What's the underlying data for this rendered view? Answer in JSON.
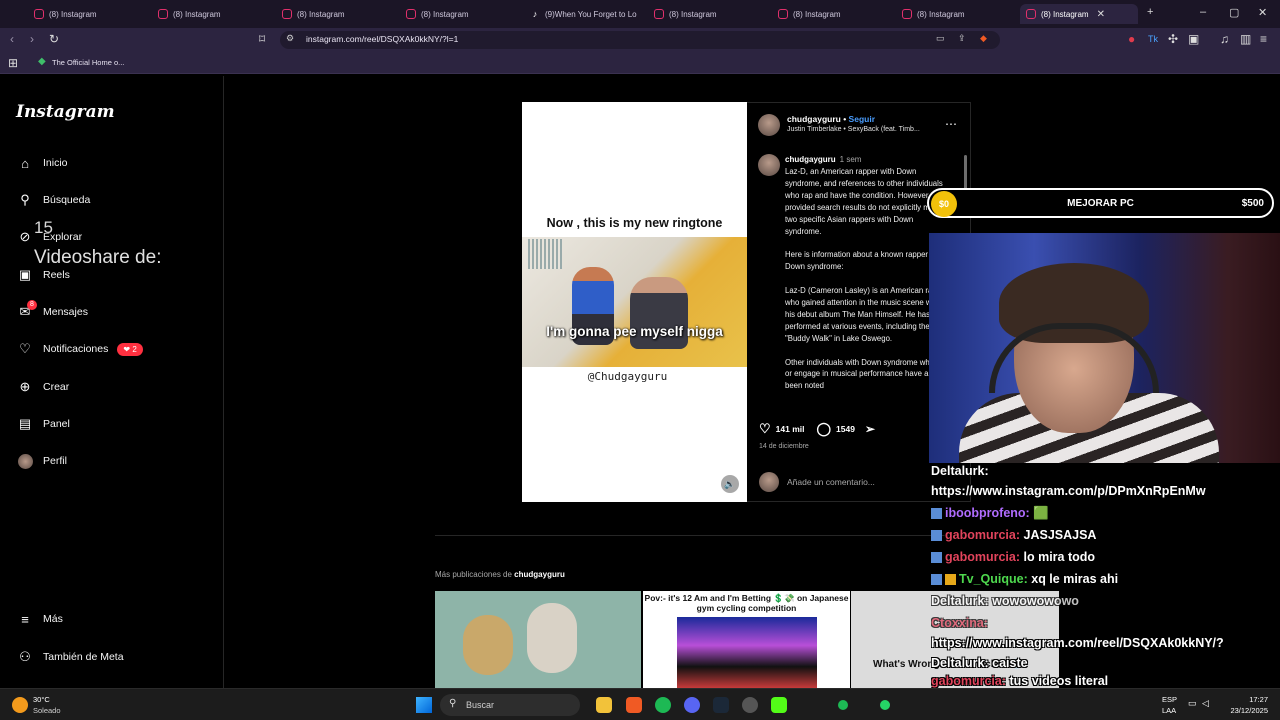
{
  "browser": {
    "tabs": [
      {
        "label": "(8) Instagram",
        "icon": "instagram-icon"
      },
      {
        "label": "(8) Instagram",
        "icon": "instagram-icon"
      },
      {
        "label": "(8) Instagram",
        "icon": "instagram-icon"
      },
      {
        "label": "(8) Instagram",
        "icon": "instagram-icon"
      },
      {
        "label": "(9)When You Forget to Lo",
        "icon": "tiktok-icon"
      },
      {
        "label": "(8) Instagram",
        "icon": "instagram-icon"
      },
      {
        "label": "(8) Instagram",
        "icon": "instagram-icon"
      },
      {
        "label": "(8) Instagram",
        "icon": "instagram-icon"
      },
      {
        "label": "(8) Instagram",
        "icon": "instagram-icon",
        "active": true
      }
    ],
    "url": "instagram.com/reel/DSQXAk0kkNY/?l=1",
    "bookmark": "The Official Home o..."
  },
  "sidebar": {
    "logo": "Instagram",
    "items": [
      {
        "label": "Inicio",
        "icon": "home-icon"
      },
      {
        "label": "Búsqueda",
        "icon": "search-icon"
      },
      {
        "label": "Explorar",
        "icon": "compass-icon"
      },
      {
        "label": "Reels",
        "icon": "reels-icon"
      },
      {
        "label": "Mensajes",
        "icon": "messenger-icon",
        "badge": "8"
      },
      {
        "label": "Notificaciones",
        "icon": "heart-icon",
        "badge": "2"
      },
      {
        "label": "Crear",
        "icon": "plus-icon"
      },
      {
        "label": "Panel",
        "icon": "dashboard-icon"
      },
      {
        "label": "Perfil",
        "icon": "avatar"
      }
    ],
    "more": "Más",
    "meta": "También de Meta"
  },
  "overlay": {
    "count": "15",
    "videoshare": "Videoshare de:"
  },
  "reel": {
    "top_text": "Now , this is my new ringtone",
    "subtitle": "I'm gonna pee myself nigga",
    "handle": "@Chudgayguru"
  },
  "post": {
    "username": "chudgayguru",
    "follow": "Seguir",
    "song": "Justin Timberlake • SexyBack (feat. Timb...",
    "caption_user": "chudgayguru",
    "caption_time": "1 sem",
    "caption": "Laz-D, an American rapper with Down syndrome, and references to other individuals who rap and have the condition. However, the provided search results do not explicitly mention two specific Asian rappers with Down syndrome.\n\nHere is information about a known rapper with Down syndrome:\n\nLaz-D (Cameron Lasley) is an American rapper who gained attention in the music scene with his debut album The Man Himself. He has performed at various events, including the \"Buddy Walk\" in Lake Oswego.\n\nOther individuals with Down syndrome who rap or engage in musical performance have also been noted",
    "likes": "141 mil",
    "comments": "1549",
    "date": "14 de diciembre",
    "comment_placeholder": "Añade un comentario..."
  },
  "more_posts": {
    "prefix": "Más publicaciones de",
    "user": "chudgayguru"
  },
  "thumbs": {
    "t2_text": "Pov:- it's 12 Am and I'm Betting 💲💸 on Japanese gym cycling competition",
    "t3_text": "What's Wrong robot chicken 💀"
  },
  "stream": {
    "upgrade": {
      "current": "$0",
      "label": "MEJORAR PC",
      "goal": "$500"
    },
    "chat": [
      {
        "user": "Deltalurk:",
        "msg": "",
        "color": "#ffffff"
      },
      {
        "user": "",
        "msg": "https://www.instagram.com/p/DPmXnRpEnMw",
        "color": "#ffffff"
      },
      {
        "user": "iboobprofeno:",
        "msg": "🟩",
        "color": "#b06cff"
      },
      {
        "user": "gabomurcia:",
        "msg": "JASJSAJSA",
        "color": "#e2445c"
      },
      {
        "user": "gabomurcia:",
        "msg": "lo mira todo",
        "color": "#e2445c"
      },
      {
        "user": "Tv_Quique:",
        "msg": "xq le miras ahi",
        "color": "#4ed84e"
      },
      {
        "user": "Deltalurk:",
        "msg": "wowowowowo",
        "color": "#ffffff"
      },
      {
        "user": "Ctoxxina:",
        "msg": "",
        "color": "#e2445c"
      },
      {
        "user": "",
        "msg": "https://www.instagram.com/reel/DSQXAk0kkNY/?",
        "color": "#ffffff"
      },
      {
        "user": "Deltalurk:",
        "msg": "caiste",
        "color": "#ffffff"
      },
      {
        "user": "gabomurcia:",
        "msg": "tus videos literal",
        "color": "#e2445c"
      }
    ]
  },
  "taskbar": {
    "temp": "30°C",
    "condition": "Soleado",
    "search": "Buscar",
    "lang1": "ESP",
    "lang2": "LAA",
    "time": "17:27",
    "date": "23/12/2025"
  }
}
